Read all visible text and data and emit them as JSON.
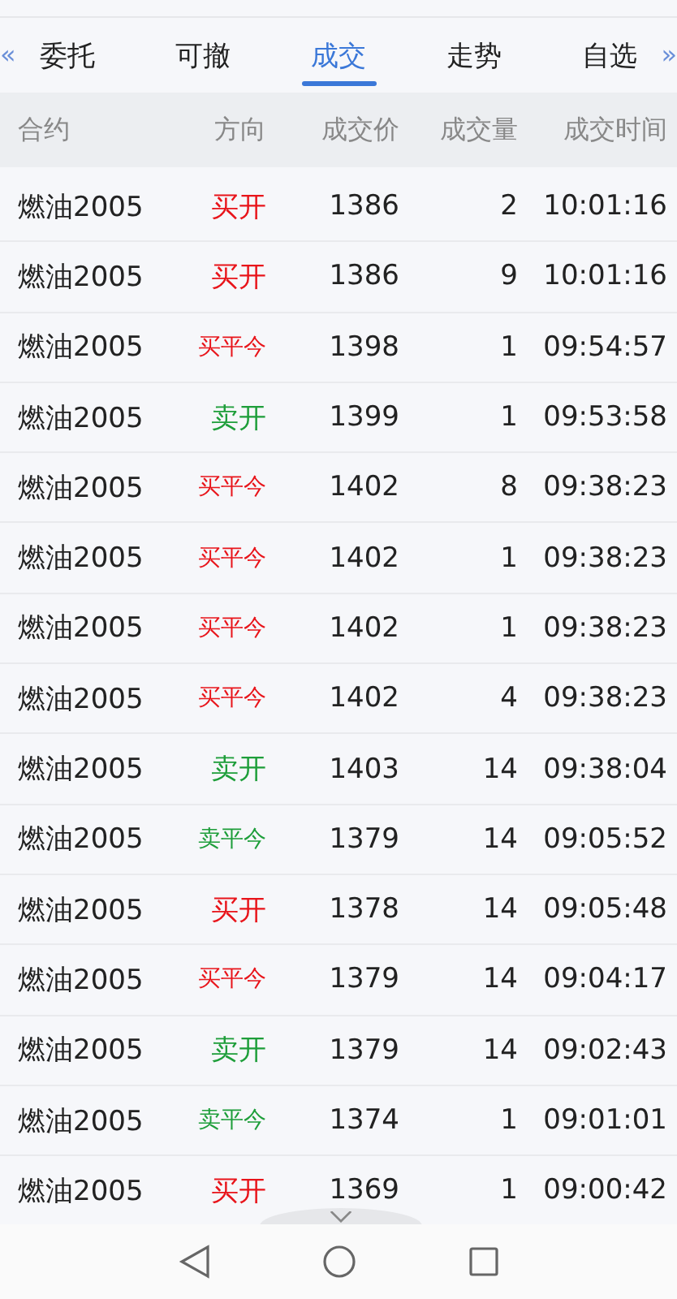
{
  "tabs": {
    "prev_arrow": "«",
    "next_arrow": "»",
    "items": [
      {
        "label": "委托",
        "selected": false
      },
      {
        "label": "可撤",
        "selected": false
      },
      {
        "label": "成交",
        "selected": true
      },
      {
        "label": "走势",
        "selected": false
      },
      {
        "label": "自选",
        "selected": false
      }
    ]
  },
  "table": {
    "columns": [
      "合约",
      "方向",
      "成交价",
      "成交量",
      "成交时间"
    ],
    "rows": [
      {
        "contract": "燃油2005",
        "direction": "买开",
        "kind": "buy",
        "price": "1386",
        "volume": "2",
        "time": "10:01:16"
      },
      {
        "contract": "燃油2005",
        "direction": "买开",
        "kind": "buy",
        "price": "1386",
        "volume": "9",
        "time": "10:01:16"
      },
      {
        "contract": "燃油2005",
        "direction": "买平今",
        "kind": "buy",
        "price": "1398",
        "volume": "1",
        "time": "09:54:57"
      },
      {
        "contract": "燃油2005",
        "direction": "卖开",
        "kind": "sell",
        "price": "1399",
        "volume": "1",
        "time": "09:53:58"
      },
      {
        "contract": "燃油2005",
        "direction": "买平今",
        "kind": "buy",
        "price": "1402",
        "volume": "8",
        "time": "09:38:23"
      },
      {
        "contract": "燃油2005",
        "direction": "买平今",
        "kind": "buy",
        "price": "1402",
        "volume": "1",
        "time": "09:38:23"
      },
      {
        "contract": "燃油2005",
        "direction": "买平今",
        "kind": "buy",
        "price": "1402",
        "volume": "1",
        "time": "09:38:23"
      },
      {
        "contract": "燃油2005",
        "direction": "买平今",
        "kind": "buy",
        "price": "1402",
        "volume": "4",
        "time": "09:38:23"
      },
      {
        "contract": "燃油2005",
        "direction": "卖开",
        "kind": "sell",
        "price": "1403",
        "volume": "14",
        "time": "09:38:04"
      },
      {
        "contract": "燃油2005",
        "direction": "卖平今",
        "kind": "sell",
        "price": "1379",
        "volume": "14",
        "time": "09:05:52"
      },
      {
        "contract": "燃油2005",
        "direction": "买开",
        "kind": "buy",
        "price": "1378",
        "volume": "14",
        "time": "09:05:48"
      },
      {
        "contract": "燃油2005",
        "direction": "买平今",
        "kind": "buy",
        "price": "1379",
        "volume": "14",
        "time": "09:04:17"
      },
      {
        "contract": "燃油2005",
        "direction": "卖开",
        "kind": "sell",
        "price": "1379",
        "volume": "14",
        "time": "09:02:43"
      },
      {
        "contract": "燃油2005",
        "direction": "卖平今",
        "kind": "sell",
        "price": "1374",
        "volume": "1",
        "time": "09:01:01"
      },
      {
        "contract": "燃油2005",
        "direction": "买开",
        "kind": "buy",
        "price": "1369",
        "volume": "1",
        "time": "09:00:42"
      }
    ]
  }
}
